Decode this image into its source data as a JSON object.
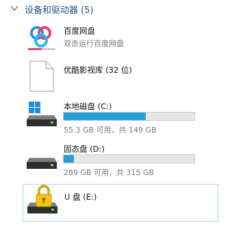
{
  "group": {
    "title": "设备和驱动器 (5)"
  },
  "items": [
    {
      "name": "百度网盘",
      "sub": "双击运行百度网盘",
      "icon": "baidu-netdisk-icon"
    },
    {
      "name": "优酷影视库 (32 位)",
      "icon": "file-icon"
    },
    {
      "name": "本地磁盘 (C:)",
      "sub": "55.3 GB 可用，共 149 GB",
      "icon": "windows-drive-icon",
      "used_fraction": 0.63
    },
    {
      "name": "固态盘 (D:)",
      "sub": "289 GB 可用，共 315 GB",
      "icon": "drive-icon",
      "used_fraction": 0.08
    },
    {
      "name": "U 盘 (E:)",
      "icon": "locked-drive-icon"
    }
  ],
  "colors": {
    "accent": "#26a0da",
    "header": "#1f4f87",
    "selection_border": "#a8d4f4"
  }
}
